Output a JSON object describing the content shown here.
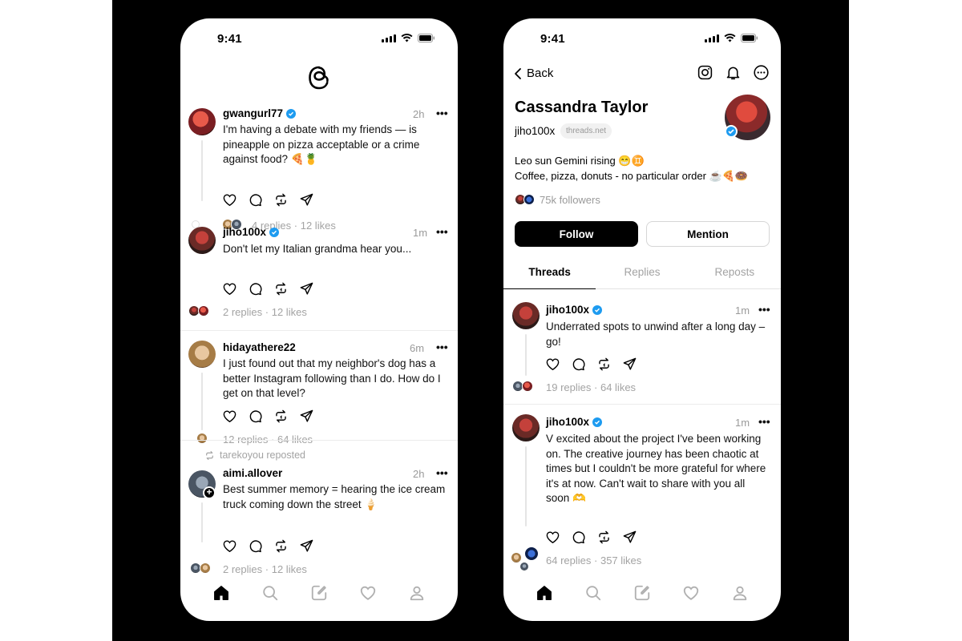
{
  "status_bar": {
    "time": "9:41"
  },
  "feed": {
    "posts": [
      {
        "username": "gwangurl77",
        "time": "2h",
        "text_lines": [
          "I'm having a debate with my friends — is",
          "pineapple on pizza acceptable or a crime",
          "against food? 🍕🍍"
        ],
        "replies": "4 replies",
        "likes": "12 likes"
      },
      {
        "username": "jiho100x",
        "time": "1m",
        "text_lines": [
          "Don't let my Italian grandma hear you..."
        ],
        "replies": "2 replies",
        "likes": "12 likes"
      },
      {
        "username": "hidayathere22",
        "time": "6m",
        "text_lines": [
          "I just found out that my neighbor's dog has a",
          "better Instagram following than I do. How do I",
          "get on that level?"
        ],
        "replies": "12 replies",
        "likes": "64 likes"
      },
      {
        "repost_note": "tarekoyou reposted",
        "username": "aimi.allover",
        "time": "2h",
        "text_lines": [
          "Best summer memory = hearing the ice cream",
          "truck coming down the street 🍦"
        ],
        "replies": "2 replies",
        "likes": "12 likes"
      }
    ],
    "separator": "·",
    "more": "•••"
  },
  "profile": {
    "back_label": "Back",
    "name": "Cassandra Taylor",
    "handle": "jiho100x",
    "domain_chip": "threads.net",
    "bio_lines": [
      "Leo sun Gemini rising 😁♊",
      "Coffee, pizza, donuts - no particular order ☕🍕🍩"
    ],
    "followers": "75k followers",
    "follow_label": "Follow",
    "mention_label": "Mention",
    "tabs": [
      "Threads",
      "Replies",
      "Reposts"
    ],
    "posts": [
      {
        "username": "jiho100x",
        "time": "1m",
        "text_lines": [
          "Underrated spots to unwind after a long day –",
          "go!"
        ],
        "replies": "19 replies",
        "likes": "64 likes"
      },
      {
        "username": "jiho100x",
        "time": "1m",
        "text_lines": [
          "V excited about the project I've been working",
          "on. The creative journey has been chaotic at",
          "times but I couldn't be more grateful for where",
          "it's at now. Can't wait to share with you all",
          "soon 🫶"
        ],
        "replies": "64 replies",
        "likes": "357 likes"
      }
    ]
  },
  "colors": {
    "verified": "#1d9bf0",
    "muted": "#a3a3a3",
    "background": "#000000"
  },
  "icons": [
    "threads-logo-icon",
    "heart-icon",
    "comment-icon",
    "repost-icon",
    "share-icon",
    "home-icon",
    "search-icon",
    "compose-icon",
    "activity-icon",
    "profile-icon",
    "instagram-icon",
    "bell-icon",
    "more-icon",
    "chevron-left-icon"
  ]
}
